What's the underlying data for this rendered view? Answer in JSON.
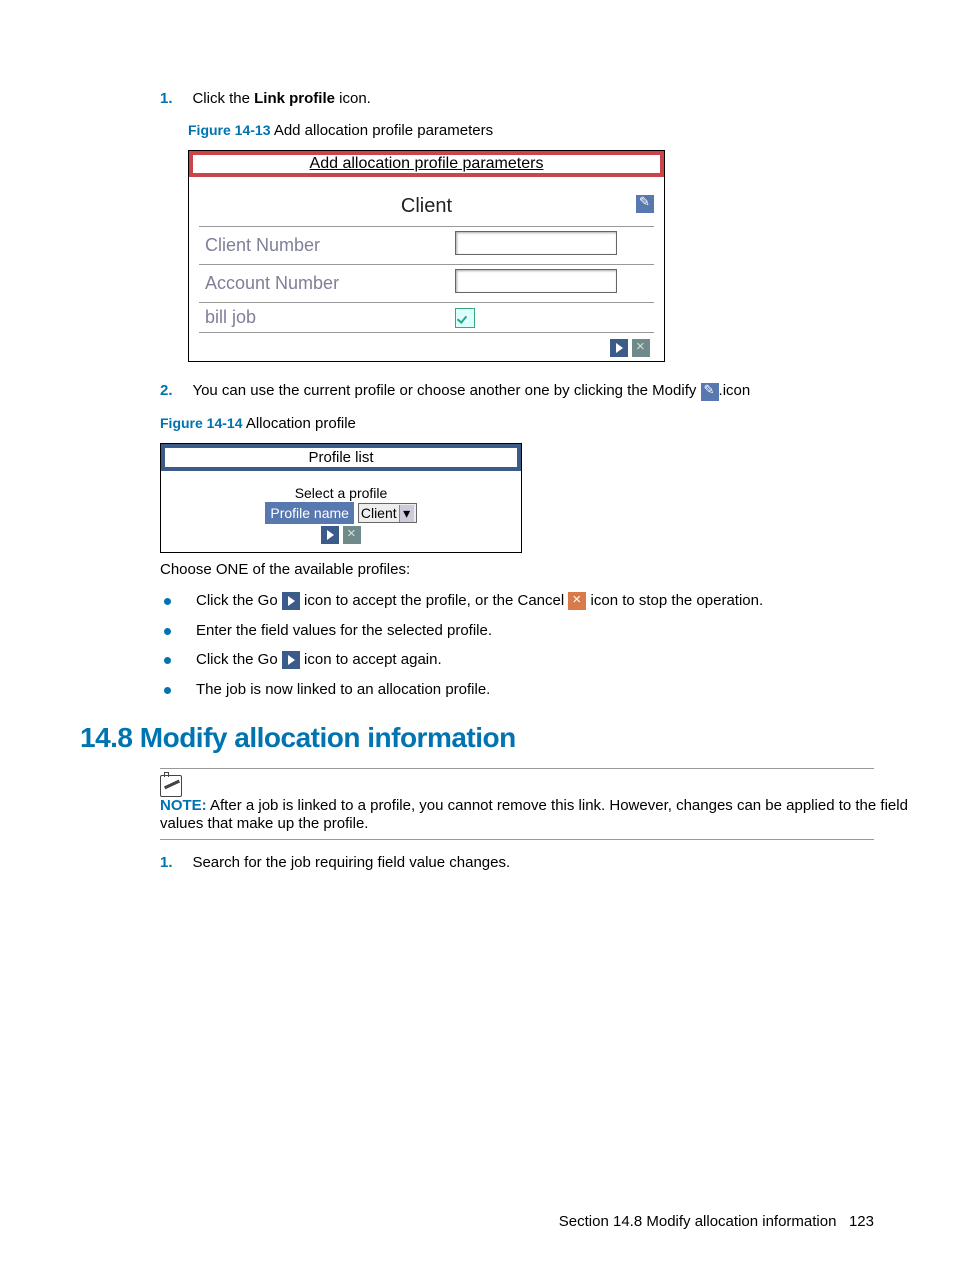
{
  "steps": {
    "s1_num": "1.",
    "s1_a": "Click the ",
    "s1_bold": "Link profile",
    "s1_b": " icon.",
    "s2_num": "2.",
    "s2_a": "You can use the current profile or choose another one by clicking the Modify ",
    "s2_b": ".icon",
    "s3_num": "1.",
    "s3_text": "Search for the job requiring field value changes."
  },
  "figs": {
    "f1_label": "Figure 14-13",
    "f1_title": "  Add allocation profile parameters",
    "f2_label": "Figure 14-14",
    "f2_title": "  Allocation profile"
  },
  "ss1": {
    "title": "Add allocation profile parameters",
    "client": "Client",
    "client_number": "Client Number",
    "account_number": "Account Number",
    "bill_job": "bill job"
  },
  "ss2": {
    "title": "Profile list",
    "select": "Select a profile",
    "profile_name": "Profile name",
    "profile_value": "Client"
  },
  "choose": "Choose ONE of the available profiles:",
  "bullets": {
    "b1a": "Click the Go ",
    "b1b": " icon to accept the profile, or the Cancel ",
    "b1c": " icon to stop the operation.",
    "b2": "Enter the field values for the selected profile.",
    "b3a": "Click the Go ",
    "b3b": " icon to accept again.",
    "b4": "The job is now linked to an allocation profile."
  },
  "section_heading": "14.8 Modify allocation information",
  "note": {
    "label": "NOTE:",
    "text": "   After a job is linked to a profile, you cannot remove this link. However, changes can be applied to the field values that make up the profile."
  },
  "footer": {
    "section": "Section 14.8  Modify allocation information",
    "page": "123"
  }
}
